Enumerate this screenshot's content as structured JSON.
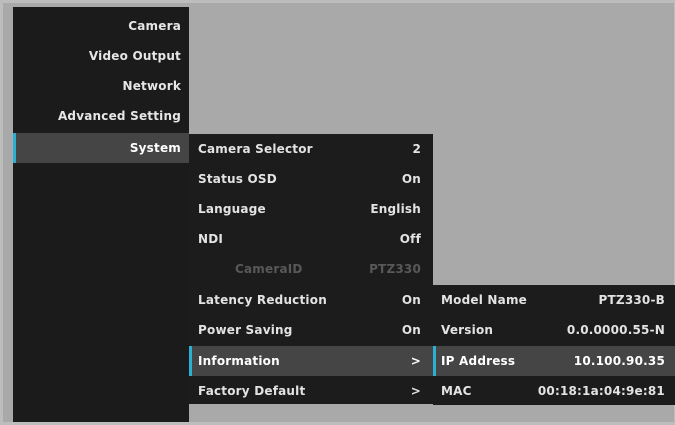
{
  "main_menu": {
    "items": [
      {
        "label": "Camera"
      },
      {
        "label": "Video Output"
      },
      {
        "label": "Network"
      },
      {
        "label": "Advanced Setting"
      },
      {
        "label": "System"
      }
    ],
    "active": "System"
  },
  "system_menu": {
    "items": [
      {
        "label": "Camera Selector",
        "value": "2"
      },
      {
        "label": "Status OSD",
        "value": "On"
      },
      {
        "label": "Language",
        "value": "English"
      },
      {
        "label": "NDI",
        "value": "Off"
      },
      {
        "label": "CameraID",
        "value": "PTZ330"
      },
      {
        "label": "Latency Reduction",
        "value": "On"
      },
      {
        "label": "Power Saving",
        "value": "On"
      },
      {
        "label": "Information",
        "value": ">"
      },
      {
        "label": "Factory Default",
        "value": ">"
      }
    ],
    "active": "Information"
  },
  "information": {
    "items": [
      {
        "label": "Model Name",
        "value": "PTZ330-B"
      },
      {
        "label": "Version",
        "value": "0.0.0000.55-N"
      },
      {
        "label": "IP Address",
        "value": "10.100.90.35"
      },
      {
        "label": "MAC",
        "value": "00:18:1a:04:9e:81"
      }
    ],
    "active": "IP Address"
  },
  "colors": {
    "highlight_bar": "#2ab0d3",
    "menu_background": "#1b1b1b",
    "selected_row": "#454545"
  }
}
